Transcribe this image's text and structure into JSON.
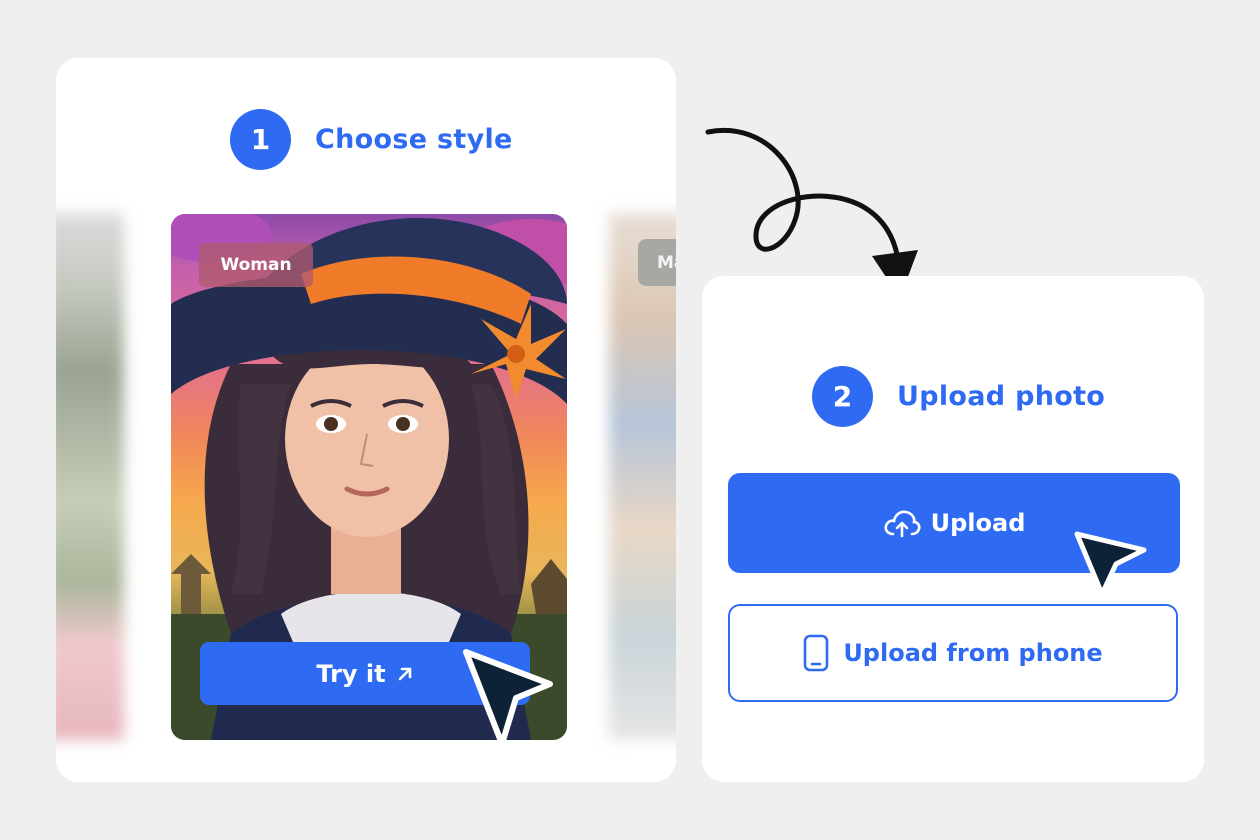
{
  "colors": {
    "accent": "#2f6bf2",
    "background": "#efefef",
    "card": "#ffffff",
    "cursor": "#0d2237"
  },
  "step1": {
    "number": "1",
    "label": "Choose style"
  },
  "style_card": {
    "tag": "Woman",
    "try_label": "Try it",
    "try_icon": "arrow-up-right-icon"
  },
  "side_card_right": {
    "tag": "Ma"
  },
  "step2": {
    "number": "2",
    "label": "Upload photo"
  },
  "upload": {
    "label": "Upload",
    "icon": "cloud-upload-icon"
  },
  "upload_phone": {
    "label": "Upload from phone",
    "icon": "smartphone-icon"
  }
}
